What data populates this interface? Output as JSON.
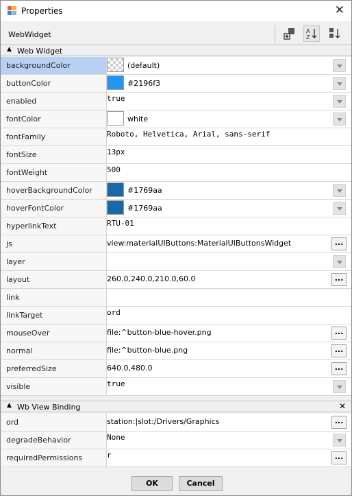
{
  "window": {
    "title": "Properties"
  },
  "toolbar": {
    "label": "WebWidget"
  },
  "sections": {
    "web_widget": "Web Widget",
    "wb_view_binding": "Wb View Binding"
  },
  "props": [
    {
      "name": "backgroundColor",
      "value": "(default)",
      "swatch": "checker"
    },
    {
      "name": "buttonColor",
      "value": "#2196f3",
      "swatch": "#2196f3"
    },
    {
      "name": "enabled",
      "value": "true"
    },
    {
      "name": "fontColor",
      "value": "white",
      "swatch": "#ffffff"
    },
    {
      "name": "fontFamily",
      "value": "Roboto, Helvetica, Arial, sans-serif"
    },
    {
      "name": "fontSize",
      "value": "13px"
    },
    {
      "name": "fontWeight",
      "value": "500"
    },
    {
      "name": "hoverBackgroundColor",
      "value": "#1769aa",
      "swatch": "#1769aa"
    },
    {
      "name": "hoverFontColor",
      "value": "#1769aa",
      "swatch": "#1769aa"
    },
    {
      "name": "hyperlinkText",
      "value": "RTU-01"
    },
    {
      "name": "js",
      "value": "view:materialUIButtons:MaterialUIButtonsWidget"
    },
    {
      "name": "layer",
      "value": ""
    },
    {
      "name": "layout",
      "value": "260.0,240.0,210.0,60.0"
    },
    {
      "name": "link",
      "value": ""
    },
    {
      "name": "linkTarget",
      "value": "ord"
    },
    {
      "name": "mouseOver",
      "value": "file:^button-blue-hover.png"
    },
    {
      "name": "normal",
      "value": "file:^button-blue.png"
    },
    {
      "name": "preferredSize",
      "value": "640.0,480.0"
    },
    {
      "name": "visible",
      "value": "true"
    }
  ],
  "binding_props": [
    {
      "name": "ord",
      "value": "station:|slot:/Drivers/Graphics"
    },
    {
      "name": "degradeBehavior",
      "value": "None"
    },
    {
      "name": "requiredPermissions",
      "value": "r"
    }
  ],
  "buttons": {
    "ellipsis": "...",
    "ok": "OK",
    "cancel": "Cancel"
  },
  "colors": {
    "selection": "#b7d1f2",
    "blue": "#2196f3",
    "dark_blue": "#1769aa"
  }
}
